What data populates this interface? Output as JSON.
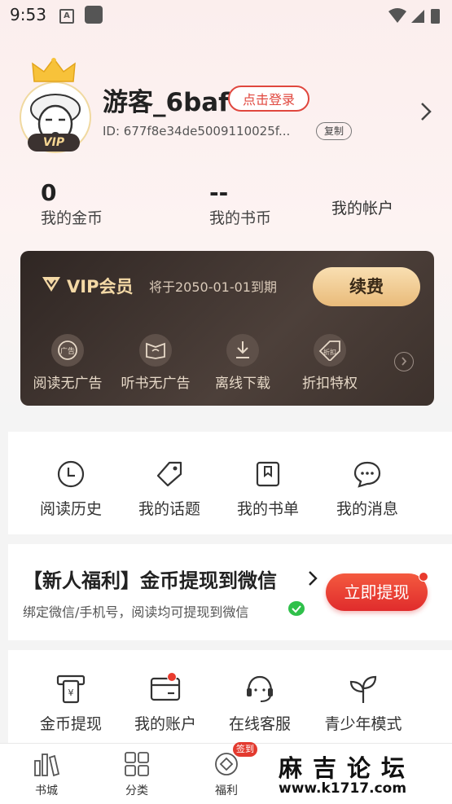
{
  "status": {
    "time": "9:53",
    "notif_letter": "A"
  },
  "profile": {
    "username": "游客_6baf",
    "login_label": "点击登录",
    "user_id": "ID: 677f8e34de5009110025f...",
    "copy_label": "复制",
    "vip_badge": "VIP"
  },
  "stats": [
    {
      "value": "0",
      "label": "我的金币"
    },
    {
      "value": "--",
      "label": "我的书币"
    },
    {
      "label": "我的帐户"
    }
  ],
  "vip": {
    "title": "VIP会员",
    "expire": "将于2050-01-01到期",
    "renew_label": "续费",
    "features": [
      {
        "label": "阅读无广告",
        "icon": "no-ads-icon",
        "icon_text": "广告"
      },
      {
        "label": "听书无广告",
        "icon": "book-audio-icon"
      },
      {
        "label": "离线下载",
        "icon": "download-icon"
      },
      {
        "label": "折扣特权",
        "icon": "discount-tag-icon",
        "icon_text": "折扣"
      }
    ]
  },
  "quick_links": [
    {
      "label": "阅读历史",
      "icon": "clock-icon"
    },
    {
      "label": "我的话题",
      "icon": "tag-icon"
    },
    {
      "label": "我的书单",
      "icon": "bookmark-icon"
    },
    {
      "label": "我的消息",
      "icon": "chat-icon"
    }
  ],
  "promo": {
    "title": "【新人福利】金币提现到微信",
    "subtitle": "绑定微信/手机号，阅读均可提现到微信",
    "button": "立即提现"
  },
  "services": [
    {
      "label": "金币提现",
      "icon": "coin-withdraw-icon",
      "icon_text": "¥"
    },
    {
      "label": "我的账户",
      "icon": "wallet-card-icon",
      "dot": true
    },
    {
      "label": "在线客服",
      "icon": "headset-icon"
    },
    {
      "label": "青少年模式",
      "icon": "sprout-icon"
    }
  ],
  "nav": [
    {
      "label": "书城",
      "icon": "bookstore-icon"
    },
    {
      "label": "分类",
      "icon": "grid-icon"
    },
    {
      "label": "福利",
      "icon": "welfare-icon",
      "badge": "签到"
    }
  ],
  "watermark": {
    "title": "麻吉论坛",
    "url": "www.k1717.com"
  },
  "colors": {
    "accent_red": "#e0473e",
    "vip_gold": "#f4d9a6",
    "vip_card_bg": "#3c312c"
  }
}
